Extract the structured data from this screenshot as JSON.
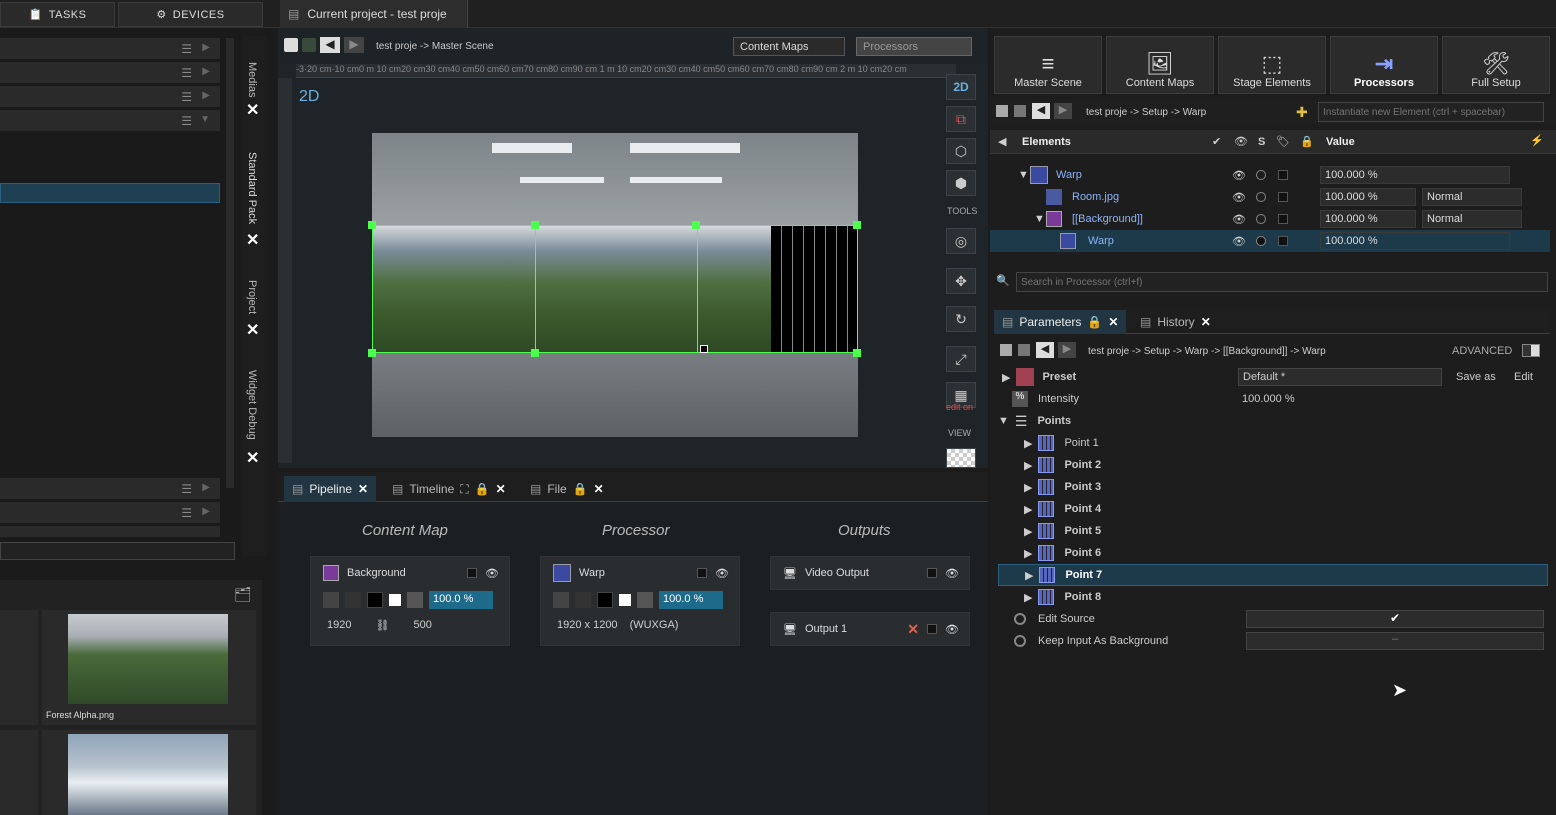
{
  "top": {
    "tasks": "TASKS",
    "devices": "DEVICES",
    "doc_title": "Current project - test proje"
  },
  "vtabs": [
    "Medias",
    "Standard Pack",
    "Project",
    "Widget Debug"
  ],
  "viewport": {
    "breadcrumb": "test proje -> Master Scene",
    "crumb1": "Content Maps",
    "crumb2": "Processors",
    "mode": "2D",
    "tools_label": "TOOLS",
    "view_label": "VIEW",
    "edit_on": "edit on",
    "ruler": "-3·20 cm·10 cm0 m 10 cm20 cm30 cm40 cm50 cm60 cm70 cm80 cm90 cm 1 m 10 cm20 cm30 cm40 cm50 cm60 cm70 cm80 cm90 cm 2 m 10 cm20 cm"
  },
  "thumbs": [
    {
      "label": "Forest Alpha.png"
    }
  ],
  "pipeline": {
    "tabs": [
      "Pipeline",
      "Timeline",
      "File"
    ],
    "col1": "Content Map",
    "col2": "Processor",
    "col3": "Outputs",
    "bg_node": {
      "name": "Background",
      "pct": "100.0 %",
      "w": "1920",
      "h": "500"
    },
    "warp_node": {
      "name": "Warp",
      "pct": "100.0 %",
      "res": "1920 x 1200",
      "res_name": "(WUXGA)"
    },
    "out1": "Video Output",
    "out2": "Output 1"
  },
  "right": {
    "buttons": [
      "Master Scene",
      "Content Maps",
      "Stage Elements",
      "Processors",
      "Full Setup"
    ],
    "breadcrumb": "test proje -> Setup -> Warp",
    "instantiate_ph": "Instantiate new Element (ctrl + spacebar)",
    "elements_label": "Elements",
    "value_label": "Value",
    "s_label": "S",
    "elements": [
      {
        "name": "Warp",
        "pct": "100.000 %",
        "blend": ""
      },
      {
        "name": "Room.jpg",
        "pct": "100.000 %",
        "blend": "Normal"
      },
      {
        "name": "[[Background]]",
        "pct": "100.000 %",
        "blend": "Normal"
      },
      {
        "name": "Warp",
        "pct": "100.000 %",
        "blend": ""
      }
    ],
    "search_ph": "Search in Processor (ctrl+f)",
    "ptabs": [
      "Parameters",
      "History"
    ],
    "param_crumb": "test proje -> Setup -> Warp -> [[Background]] -> Warp",
    "advanced": "ADVANCED",
    "preset_label": "Preset",
    "preset_val": "Default *",
    "save_as": "Save as",
    "edit": "Edit",
    "intensity_label": "Intensity",
    "intensity_val": "100.000 %",
    "points_label": "Points",
    "points": [
      "Point 1",
      "Point 2",
      "Point 3",
      "Point 4",
      "Point 5",
      "Point 6",
      "Point 7",
      "Point 8"
    ],
    "edit_source": "Edit Source",
    "keep_input": "Keep Input As Background"
  }
}
